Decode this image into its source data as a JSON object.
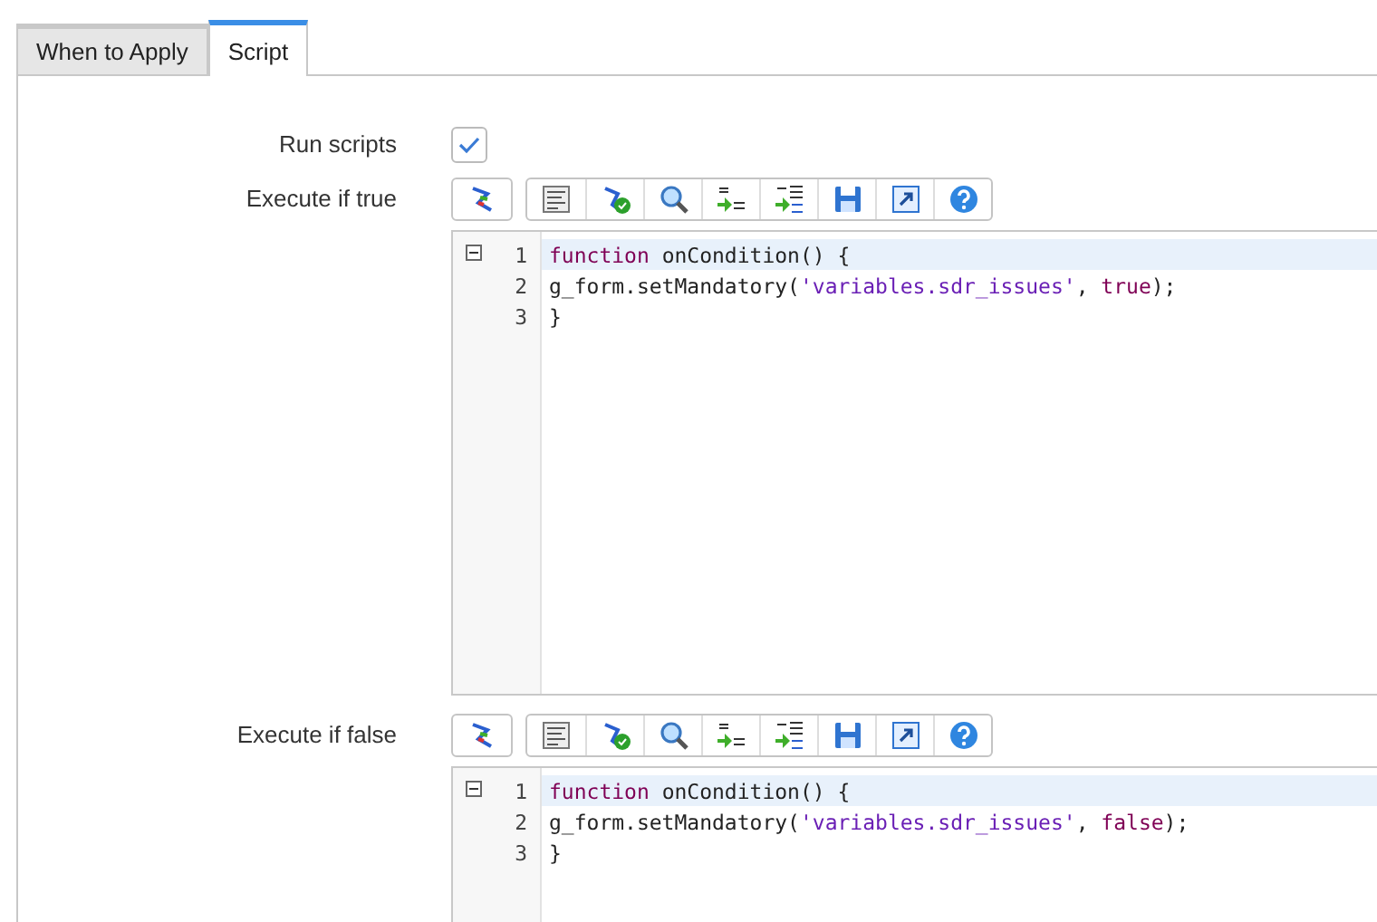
{
  "tabs": [
    {
      "label": "When to Apply",
      "selected": false
    },
    {
      "label": "Script",
      "selected": true
    }
  ],
  "run_scripts": {
    "label": "Run scripts",
    "checked": true
  },
  "editors": [
    {
      "label": "Execute if true",
      "lines": [
        {
          "number": "1",
          "selected": true,
          "tokens": [
            {
              "kind": "keyword",
              "text": "function"
            },
            {
              "kind": "plain",
              "text": " onCondition() {"
            }
          ]
        },
        {
          "number": "2",
          "selected": false,
          "tokens": [
            {
              "kind": "plain",
              "text": "g_form.setMandatory("
            },
            {
              "kind": "string",
              "text": "'variables.sdr_issues'"
            },
            {
              "kind": "plain",
              "text": ", "
            },
            {
              "kind": "keyword",
              "text": "true"
            },
            {
              "kind": "plain",
              "text": ");"
            }
          ]
        },
        {
          "number": "3",
          "selected": false,
          "tokens": [
            {
              "kind": "plain",
              "text": "}"
            }
          ]
        }
      ]
    },
    {
      "label": "Execute if false",
      "lines": [
        {
          "number": "1",
          "selected": true,
          "tokens": [
            {
              "kind": "keyword",
              "text": "function"
            },
            {
              "kind": "plain",
              "text": " onCondition() {"
            }
          ]
        },
        {
          "number": "2",
          "selected": false,
          "tokens": [
            {
              "kind": "plain",
              "text": "g_form.setMandatory("
            },
            {
              "kind": "string",
              "text": "'variables.sdr_issues'"
            },
            {
              "kind": "plain",
              "text": ", "
            },
            {
              "kind": "keyword",
              "text": "false"
            },
            {
              "kind": "plain",
              "text": ");"
            }
          ]
        },
        {
          "number": "3",
          "selected": false,
          "tokens": [
            {
              "kind": "plain",
              "text": "}"
            }
          ]
        }
      ]
    }
  ]
}
